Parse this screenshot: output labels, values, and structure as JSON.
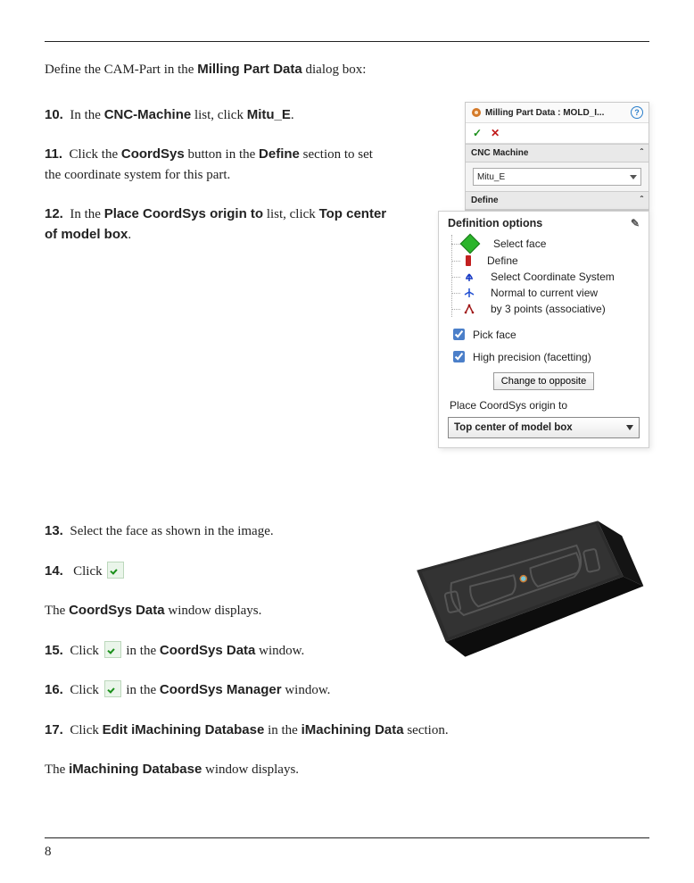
{
  "page_number": "8",
  "intro": {
    "pre": "Define the CAM-Part in the ",
    "b1": "Milling Part Data",
    "post": " dialog box:"
  },
  "steps": {
    "s10": {
      "num": "10.",
      "t1": "In the ",
      "b1": "CNC-Machine",
      "t2": " list, click ",
      "b2": "Mitu_E",
      "t3": "."
    },
    "s11": {
      "num": "11.",
      "t1": "Click the ",
      "b1": "CoordSys",
      "t2": " button in the ",
      "b2": "Define",
      "t3": " section to set the coordinate system for this part."
    },
    "s12": {
      "num": "12.",
      "t1": "In the ",
      "b1": "Place CoordSys origin to",
      "t2": " list, click ",
      "b2": "Top center of model box",
      "t3": "."
    },
    "s13": {
      "num": "13.",
      "t1": "Select the face as shown in the image."
    },
    "s14": {
      "num": "14.",
      "t1": "Click "
    },
    "s14_after": {
      "t1": "The ",
      "b1": "CoordSys Data",
      "t2": " window displays."
    },
    "s15": {
      "num": "15.",
      "t1": "Click ",
      "t2": " in the ",
      "b1": "CoordSys Data",
      "t3": " window."
    },
    "s16": {
      "num": "16.",
      "t1": "Click ",
      "t2": " in the ",
      "b1": "CoordSys Manager",
      "t3": " window."
    },
    "s17": {
      "num": "17.",
      "t1": "Click ",
      "b1": "Edit iMachining Database",
      "t2": " in the ",
      "b2": "iMachining Data",
      "t3": " section."
    },
    "s17_after": {
      "t1": "The ",
      "b1": "iMachining Database",
      "t2": " window displays."
    }
  },
  "panel_mill": {
    "title": "Milling Part Data : MOLD_I...",
    "help": "?",
    "ok": "✓",
    "x": "✕",
    "sect_machine": "CNC Machine",
    "machine_value": "Mitu_E",
    "sect_define": "Define",
    "chev": "ˆ"
  },
  "panel_def": {
    "title": "Definition options",
    "pencil": "✎",
    "nodes": {
      "n0": "Select face",
      "n1": "Define",
      "n2": "Select Coordinate System",
      "n3": "Normal to current view",
      "n4": "by 3 points (associative)"
    },
    "chk_pick": "Pick face",
    "chk_hp": "High precision (facetting)",
    "btn_change": "Change to opposite",
    "place_label": "Place CoordSys origin to",
    "place_value": "Top center of model box"
  }
}
